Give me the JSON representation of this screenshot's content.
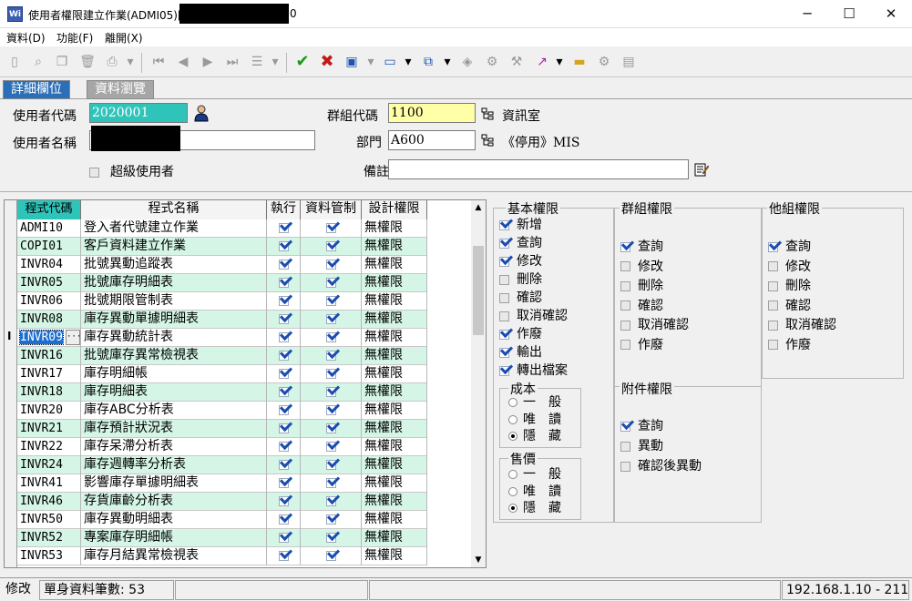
{
  "window": {
    "app_icon": "Wi",
    "title": "使用者權限建立作業(ADMI05)[",
    "title_suffix": "0",
    "minimize": "─",
    "maximize": "☐",
    "close": "✕"
  },
  "menu": {
    "items": [
      "資料(D)",
      "功能(F)",
      "離開(X)"
    ]
  },
  "tabs": [
    {
      "label": "詳細欄位",
      "active": true
    },
    {
      "label": "資料瀏覽",
      "active": false
    }
  ],
  "form": {
    "user_code_label": "使用者代碼",
    "user_code_value": "2020001",
    "user_name_label": "使用者名稱",
    "super_user_label": "超級使用者",
    "group_code_label": "群組代碼",
    "group_code_value": "1100",
    "group_name": "資訊室",
    "dept_label": "部門",
    "dept_value": "A600",
    "dept_name": "《停用》MIS",
    "remark_label": "備註",
    "remark_value": ""
  },
  "grid": {
    "headers": [
      "程式代碼",
      "程式名稱",
      "執行",
      "資料管制",
      "設計權限"
    ],
    "current_row_marker": "I",
    "ellipsis": "···",
    "rows": [
      {
        "code": "ADMI10",
        "name": "登入者代號建立作業",
        "design": "無權限"
      },
      {
        "code": "COPI01",
        "name": "客戶資料建立作業",
        "design": "無權限"
      },
      {
        "code": "INVR04",
        "name": "批號異動追蹤表",
        "design": "無權限"
      },
      {
        "code": "INVR05",
        "name": "批號庫存明細表",
        "design": "無權限"
      },
      {
        "code": "INVR06",
        "name": "批號期限管制表",
        "design": "無權限"
      },
      {
        "code": "INVR08",
        "name": "庫存異動單據明細表",
        "design": "無權限"
      },
      {
        "code": "INVR09",
        "name": "庫存異動統計表",
        "design": "無權限"
      },
      {
        "code": "INVR16",
        "name": "批號庫存異常檢視表",
        "design": "無權限"
      },
      {
        "code": "INVR17",
        "name": "庫存明細帳",
        "design": "無權限"
      },
      {
        "code": "INVR18",
        "name": "庫存明細表",
        "design": "無權限"
      },
      {
        "code": "INVR20",
        "name": "庫存ABC分析表",
        "design": "無權限"
      },
      {
        "code": "INVR21",
        "name": "庫存預計狀況表",
        "design": "無權限"
      },
      {
        "code": "INVR22",
        "name": "庫存呆滯分析表",
        "design": "無權限"
      },
      {
        "code": "INVR24",
        "name": "庫存週轉率分析表",
        "design": "無權限"
      },
      {
        "code": "INVR41",
        "name": "影響庫存單據明細表",
        "design": "無權限"
      },
      {
        "code": "INVR46",
        "name": "存貨庫齡分析表",
        "design": "無權限"
      },
      {
        "code": "INVR50",
        "name": "庫存異動明細表",
        "design": "無權限"
      },
      {
        "code": "INVR52",
        "name": "專案庫存明細帳",
        "design": "無權限"
      },
      {
        "code": "INVR53",
        "name": "庫存月結異常檢視表",
        "design": "無權限"
      }
    ]
  },
  "basic_perms": {
    "title": "基本權限",
    "items": [
      {
        "label": "新增",
        "checked": true
      },
      {
        "label": "查詢",
        "checked": true
      },
      {
        "label": "修改",
        "checked": true
      },
      {
        "label": "刪除",
        "checked": false
      },
      {
        "label": "確認",
        "checked": false
      },
      {
        "label": "取消確認",
        "checked": false
      },
      {
        "label": "作廢",
        "checked": true
      },
      {
        "label": "輸出",
        "checked": true
      },
      {
        "label": "轉出檔案",
        "checked": true
      }
    ]
  },
  "cost": {
    "title": "成本",
    "options": [
      "一　般",
      "唯　讀",
      "隱　藏"
    ],
    "selected": 2
  },
  "price": {
    "title": "售價",
    "options": [
      "一　般",
      "唯　讀",
      "隱　藏"
    ],
    "selected": 2
  },
  "group_perms": {
    "title": "群組權限",
    "items": [
      {
        "label": "查詢",
        "checked": true
      },
      {
        "label": "修改",
        "checked": false
      },
      {
        "label": "刪除",
        "checked": false
      },
      {
        "label": "確認",
        "checked": false
      },
      {
        "label": "取消確認",
        "checked": false
      },
      {
        "label": "作廢",
        "checked": false
      }
    ]
  },
  "other_group_perms": {
    "title": "他組權限",
    "items": [
      {
        "label": "查詢",
        "checked": true
      },
      {
        "label": "修改",
        "checked": false
      },
      {
        "label": "刪除",
        "checked": false
      },
      {
        "label": "確認",
        "checked": false
      },
      {
        "label": "取消確認",
        "checked": false
      },
      {
        "label": "作廢",
        "checked": false
      }
    ]
  },
  "attach_perms": {
    "title": "附件權限",
    "items": [
      {
        "label": "查詢",
        "checked": true
      },
      {
        "label": "異動",
        "checked": false
      },
      {
        "label": "確認後異動",
        "checked": false
      }
    ]
  },
  "status": {
    "mode": "修改",
    "count": "單身資料筆數: 53",
    "server": "192.168.1.10 - 211"
  }
}
